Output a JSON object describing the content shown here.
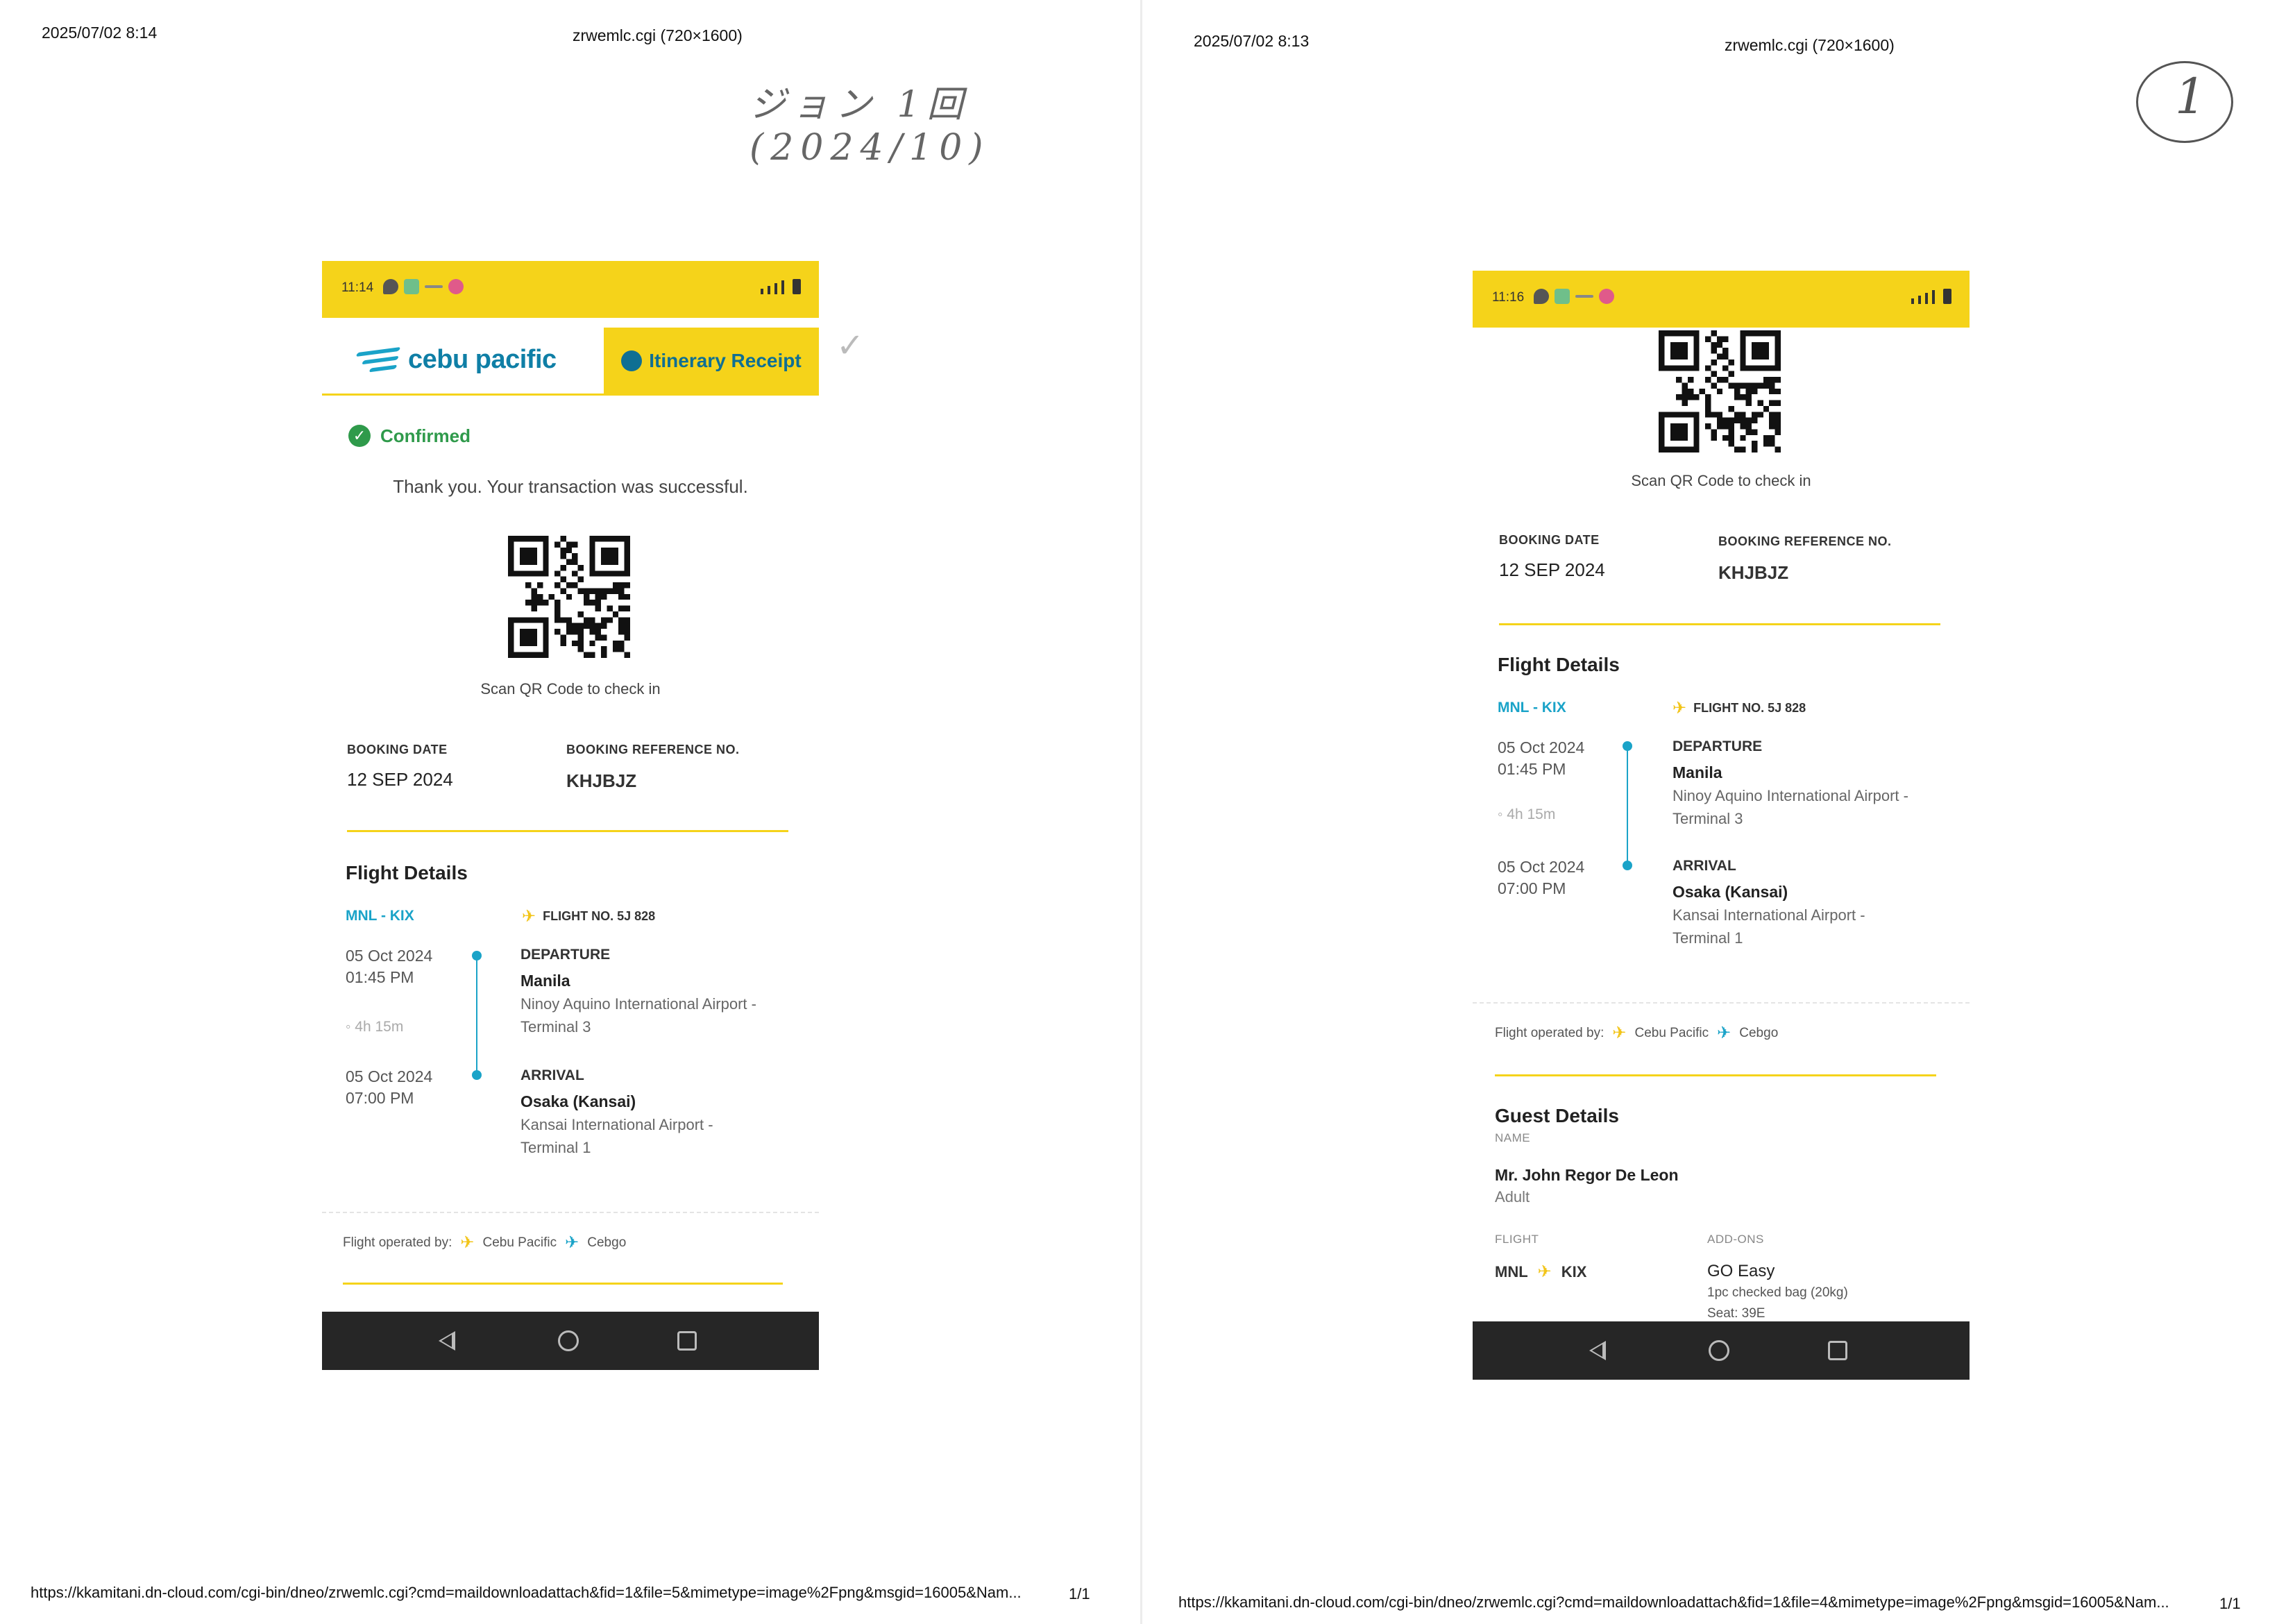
{
  "print": {
    "left": {
      "timestamp": "2025/07/02 8:14",
      "title": "zrwemlc.cgi (720×1600)",
      "url": "https://kkamitani.dn-cloud.com/cgi-bin/dneo/zrwemlc.cgi?cmd=maildownloadattach&fid=1&file=5&mimetype=image%2Fpng&msgid=16005&Nam...",
      "page": "1/1"
    },
    "right": {
      "timestamp": "2025/07/02 8:13",
      "title": "zrwemlc.cgi (720×1600)",
      "url": "https://kkamitani.dn-cloud.com/cgi-bin/dneo/zrwemlc.cgi?cmd=maildownloadattach&fid=1&file=4&mimetype=image%2Fpng&msgid=16005&Nam...",
      "page": "1/1"
    }
  },
  "annotations": {
    "handwriting_left": "ジョン 1回 (2024/10)",
    "circled_number": "1"
  },
  "screen1": {
    "status_time": "11:14",
    "brand_name": "cebu pacific",
    "receipt_button": "Itinerary Receipt",
    "confirmed_label": "Confirmed",
    "thanks_message": "Thank you. Your transaction was successful."
  },
  "screen2": {
    "status_time": "11:16"
  },
  "booking": {
    "scan_label": "Scan QR Code to check in",
    "booking_date_label": "BOOKING DATE",
    "booking_date": "12 SEP 2024",
    "reference_label": "BOOKING REFERENCE NO.",
    "reference": "KHJBJZ"
  },
  "flight": {
    "section_title": "Flight Details",
    "route": "MNL - KIX",
    "flight_no": "FLIGHT NO. 5J 828",
    "departure": {
      "date": "05 Oct 2024",
      "time": "01:45 PM",
      "label": "DEPARTURE",
      "city": "Manila",
      "airport": "Ninoy Aquino International Airport - Terminal 3"
    },
    "duration": "4h 15m",
    "arrival": {
      "date": "05 Oct 2024",
      "time": "07:00 PM",
      "label": "ARRIVAL",
      "city": "Osaka (Kansai)",
      "airport": "Kansai International Airport - Terminal 1"
    },
    "operated_by_label": "Flight operated by:",
    "operators": [
      "Cebu Pacific",
      "Cebgo"
    ]
  },
  "guest": {
    "section_title": "Guest Details",
    "name_label": "NAME",
    "name": "Mr. John Regor De Leon",
    "type": "Adult",
    "flight_label": "FLIGHT",
    "from": "MNL",
    "to": "KIX",
    "addons_label": "ADD-ONS",
    "addon_bundle": "GO Easy",
    "addon_bag": "1pc checked bag (20kg)",
    "addon_seat": "Seat: 39E"
  },
  "colors": {
    "brand_yellow": "#f5d31a",
    "brand_blue": "#1aa3c8",
    "confirmed_green": "#2f9a4b",
    "navbar_dark": "#262626"
  },
  "icons": [
    "chat-bubble-icon",
    "app-icon",
    "signal-icon",
    "battery-icon",
    "check-circle-icon",
    "receipt-icon",
    "plane-icon",
    "clock-icon",
    "back-nav-icon",
    "home-nav-icon",
    "recents-nav-icon"
  ]
}
